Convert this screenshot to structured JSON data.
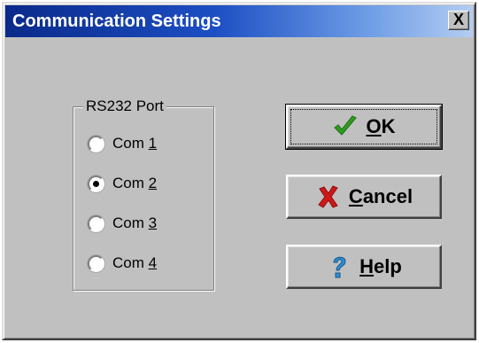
{
  "window": {
    "title": "Communication Settings",
    "close_label": "X"
  },
  "rs232": {
    "legend": "RS232 Port",
    "options": [
      {
        "prefix": "Com ",
        "accel": "1",
        "selected": false
      },
      {
        "prefix": "Com ",
        "accel": "2",
        "selected": true
      },
      {
        "prefix": "Com ",
        "accel": "3",
        "selected": false
      },
      {
        "prefix": "Com ",
        "accel": "4",
        "selected": false
      }
    ]
  },
  "buttons": {
    "ok": {
      "accel": "O",
      "rest": "K",
      "icon": "checkmark-icon",
      "color": "#2e9d1e"
    },
    "cancel": {
      "accel": "C",
      "rest": "ancel",
      "icon": "red-x-icon",
      "color": "#d01818"
    },
    "help": {
      "accel": "H",
      "rest": "elp",
      "icon": "question-mark-icon",
      "color": "#2b8fd8"
    }
  },
  "colors": {
    "dialog_face": "#c0c0c0",
    "titlebar_start": "#0a2a8a",
    "titlebar_end": "#b4cdf2"
  }
}
